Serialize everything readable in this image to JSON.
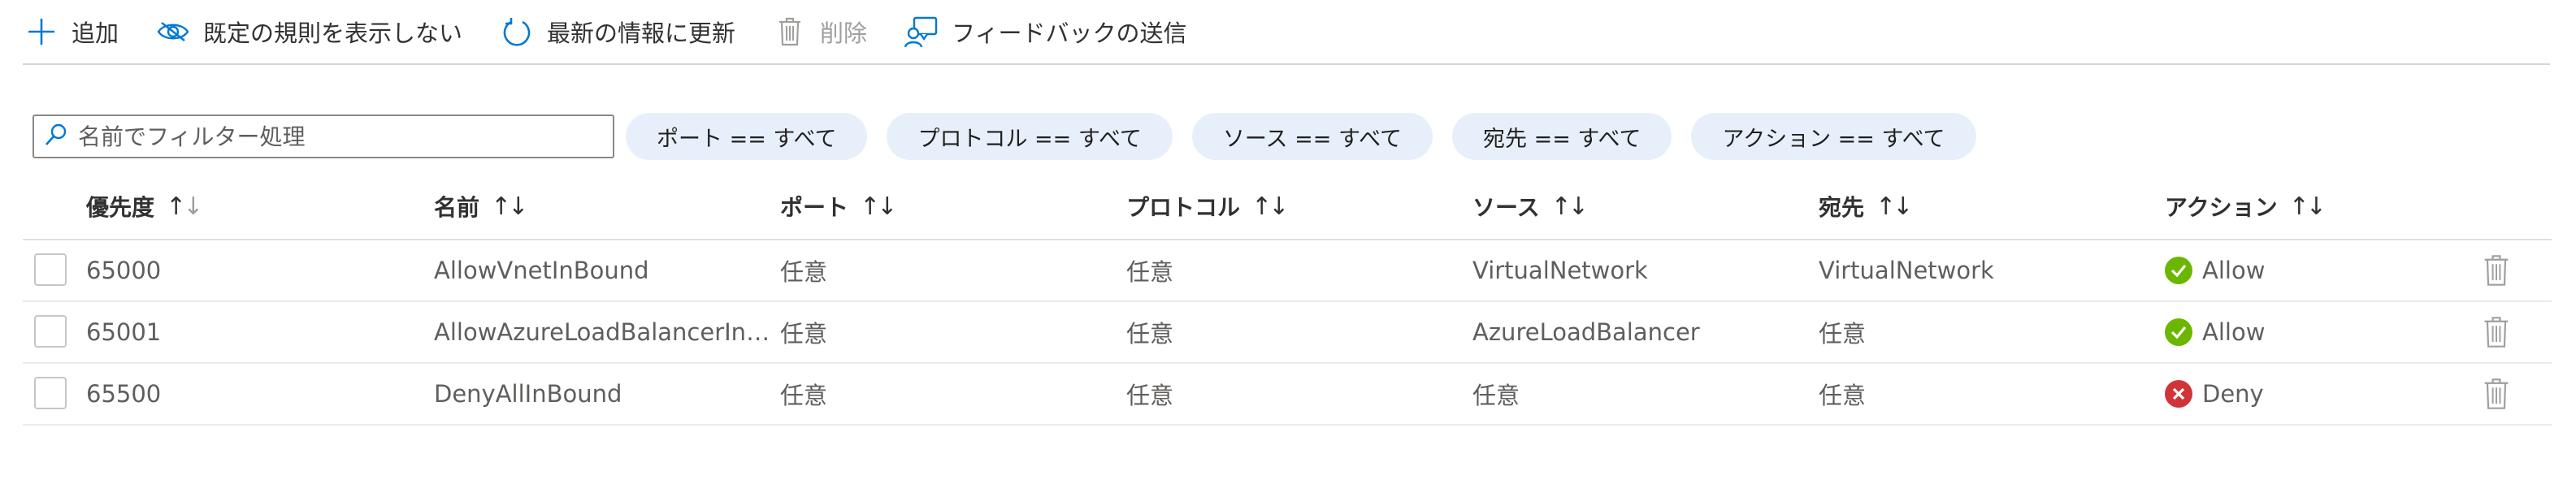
{
  "toolbar": {
    "add": {
      "label": "追加",
      "icon": "plus-icon"
    },
    "hide_default": {
      "label": "既定の規則を表示しない",
      "icon": "eye-hide-icon"
    },
    "refresh": {
      "label": "最新の情報に更新",
      "icon": "refresh-icon"
    },
    "delete": {
      "label": "削除",
      "icon": "trash-icon",
      "disabled": true
    },
    "feedback": {
      "label": "フィードバックの送信",
      "icon": "feedback-icon"
    }
  },
  "filter": {
    "search_placeholder": "名前でフィルター処理",
    "search_value": "",
    "pills": [
      "ポート == すべて",
      "プロトコル == すべて",
      "ソース == すべて",
      "宛先 == すべて",
      "アクション == すべて"
    ]
  },
  "table": {
    "columns": [
      "優先度",
      "名前",
      "ポート",
      "プロトコル",
      "ソース",
      "宛先",
      "アクション"
    ],
    "rows": [
      {
        "priority": "65000",
        "name": "AllowVnetInBound",
        "port": "任意",
        "protocol": "任意",
        "source": "VirtualNetwork",
        "destination": "VirtualNetwork",
        "action": "Allow"
      },
      {
        "priority": "65001",
        "name": "AllowAzureLoadBalancerIn…",
        "port": "任意",
        "protocol": "任意",
        "source": "AzureLoadBalancer",
        "destination": "任意",
        "action": "Allow"
      },
      {
        "priority": "65500",
        "name": "DenyAllInBound",
        "port": "任意",
        "protocol": "任意",
        "source": "任意",
        "destination": "任意",
        "action": "Deny"
      }
    ]
  },
  "colors": {
    "accent": "#0078d4",
    "allow": "#6bb700",
    "deny": "#d13438",
    "pill_bg": "#e7f0fa",
    "disabled": "#a19f9d"
  }
}
